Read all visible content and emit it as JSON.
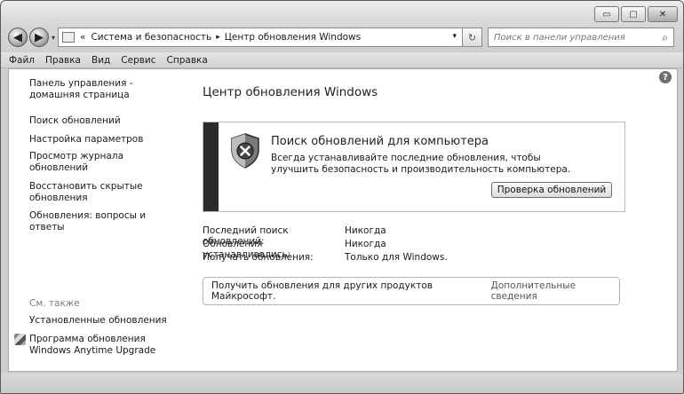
{
  "window": {
    "minimize_glyph": "▭",
    "maximize_glyph": "▢",
    "close_glyph": "✕"
  },
  "nav": {
    "back_glyph": "◀",
    "forward_glyph": "▶",
    "recent_glyph": "▾",
    "breadcrumb_root_glyph": "«",
    "breadcrumb_sep_glyph": "▸",
    "breadcrumb": [
      "Система и безопасность",
      "Центр обновления Windows"
    ],
    "address_dropdown_glyph": "▾",
    "refresh_glyph": "↻",
    "search_placeholder": "Поиск в панели управления",
    "search_glyph": "⌕"
  },
  "menu": [
    "Файл",
    "Правка",
    "Вид",
    "Сервис",
    "Справка"
  ],
  "sidebar": {
    "home": "Панель управления - домашняя страница",
    "links": [
      "Поиск обновлений",
      "Настройка параметров",
      "Просмотр журнала обновлений",
      "Восстановить скрытые обновления",
      "Обновления: вопросы и ответы"
    ],
    "see_also_label": "См. также",
    "see_also": [
      "Установленные обновления",
      "Программа обновления Windows Anytime Upgrade"
    ]
  },
  "help_glyph": "?",
  "main": {
    "title": "Центр обновления Windows",
    "status": {
      "heading": "Поиск обновлений для компьютера",
      "description": "Всегда устанавливайте последние обновления, чтобы улучшить безопасность и производительность компьютера.",
      "button": "Проверка обновлений"
    },
    "info": [
      {
        "label": "Последний поиск обновлений:",
        "value": "Никогда"
      },
      {
        "label": "Обновления устанавливались:",
        "value": "Никогда"
      },
      {
        "label": "Получать обновления:",
        "value": "Только для Windows."
      }
    ],
    "notice": {
      "text": "Получить обновления для других продуктов Майкрософт.",
      "link": "Дополнительные сведения"
    }
  }
}
